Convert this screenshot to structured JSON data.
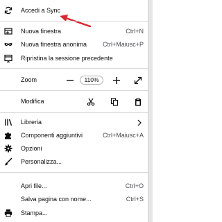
{
  "menu": {
    "sync": {
      "label": "Accedi a Sync",
      "icon": "sync-icon"
    },
    "new_window": {
      "label": "Nuova finestra",
      "shortcut": "Ctrl+N",
      "icon": "new-window-icon"
    },
    "private_window": {
      "label": "Nuova finestra anonima",
      "shortcut": "Ctrl+Maiusc+P",
      "icon": "private-mask-icon"
    },
    "restore_session": {
      "label": "Ripristina la sessione precedente",
      "icon": "restore-session-icon"
    },
    "zoom": {
      "label": "Zoom",
      "level": "110%",
      "zoom_out_icon": "minus-icon",
      "zoom_in_icon": "plus-icon",
      "fullscreen_icon": "fullscreen-icon"
    },
    "edit": {
      "label": "Modifica",
      "cut_icon": "scissors-icon",
      "copy_icon": "copy-icon",
      "paste_icon": "paste-icon"
    },
    "library": {
      "label": "Libreria",
      "icon": "library-icon",
      "submenu_icon": "chevron-right-icon"
    },
    "addons": {
      "label": "Componenti aggiuntivi",
      "shortcut": "Ctrl+Maiusc+A",
      "icon": "puzzle-icon"
    },
    "options": {
      "label": "Opzioni",
      "icon": "gear-icon"
    },
    "customize": {
      "label": "Personalizza..."
    },
    "open_file": {
      "label": "Apri file...",
      "shortcut": "Ctrl+O"
    },
    "save_page": {
      "label": "Salva pagina con nome...",
      "shortcut": "Ctrl+S"
    },
    "print": {
      "label": "Stampa...",
      "icon": "print-icon"
    }
  },
  "colors": {
    "annotation_arrow": "#d9282f",
    "separator": "#d7d7db",
    "text": "#0c0c0d"
  }
}
